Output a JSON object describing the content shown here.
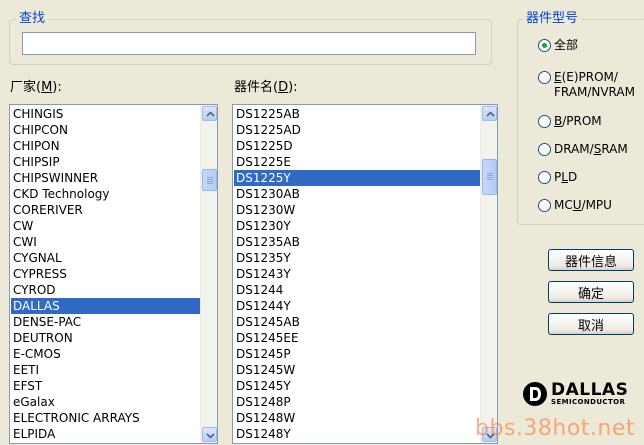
{
  "search": {
    "legend": "查找",
    "value": ""
  },
  "manufacturer": {
    "label_prefix": "厂家(",
    "label_key": "M",
    "label_suffix": "):",
    "items": [
      "CHINGIS",
      "CHIPCON",
      "CHIPON",
      "CHIPSIP",
      "CHIPSWINNER",
      "CKD Technology",
      "CORERIVER",
      "CW",
      "CWI",
      "CYGNAL",
      "CYPRESS",
      "CYROD",
      "DALLAS",
      "DENSE-PAC",
      "DEUTRON",
      "E-CMOS",
      "EETI",
      "EFST",
      "eGalax",
      "ELECTRONIC ARRAYS",
      "ELPIDA"
    ],
    "selected": "DALLAS"
  },
  "device": {
    "label_prefix": "器件名(",
    "label_key": "D",
    "label_suffix": "):",
    "items": [
      "DS1225AB",
      "DS1225AD",
      "DS1225D",
      "DS1225E",
      "DS1225Y",
      "DS1230AB",
      "DS1230W",
      "DS1230Y",
      "DS1235AB",
      "DS1235Y",
      "DS1243Y",
      "DS1244",
      "DS1244Y",
      "DS1245AB",
      "DS1245EE",
      "DS1245P",
      "DS1245W",
      "DS1245Y",
      "DS1248P",
      "DS1248W",
      "DS1248Y"
    ],
    "selected": "DS1225Y"
  },
  "device_type": {
    "legend": "器件型号",
    "options": [
      {
        "pre": "全部",
        "key": "",
        "post": "",
        "line2": "",
        "checked": true
      },
      {
        "pre": "",
        "key": "E",
        "post": "(E)PROM/",
        "line2": "FRAM/NVRAM",
        "checked": false
      },
      {
        "pre": "",
        "key": "B",
        "post": "/PROM",
        "line2": "",
        "checked": false
      },
      {
        "pre": "DRAM/",
        "key": "S",
        "post": "RAM",
        "line2": "",
        "checked": false
      },
      {
        "pre": "P",
        "key": "L",
        "post": "D",
        "line2": "",
        "checked": false
      },
      {
        "pre": "MC",
        "key": "U",
        "post": "/MPU",
        "line2": "",
        "checked": false
      }
    ]
  },
  "buttons": {
    "info": "器件信息",
    "ok": "确定",
    "cancel": "取消"
  },
  "logo": {
    "main": "DALLAS",
    "sub": "SEMICONDUCTOR"
  },
  "watermark": "bbs.38hot.net",
  "colors": {
    "selection": "#316AC5",
    "legend": "#0046D5",
    "radio_dot": "#21A121",
    "background": "#ECE9D8"
  }
}
